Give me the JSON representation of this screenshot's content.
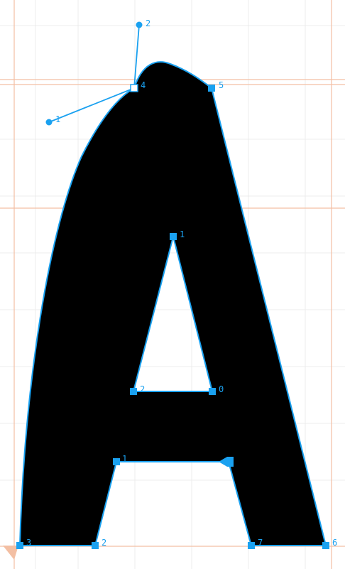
{
  "editor": {
    "glyph": "A",
    "colors": {
      "background": "#ffffff",
      "grid": "#ececec",
      "guide": "#f3bfa3",
      "glyph_fill": "#000000",
      "outline": "#1aa1f0",
      "node": "#1aa1f0",
      "selected_node": "#ffffff"
    }
  },
  "points": {
    "handle_top": "2",
    "handle_left": "1",
    "corner_top": "4",
    "corner_top_right": "5",
    "counter_top": "1",
    "counter_left": "2",
    "counter_right": "0",
    "bar_left": "1",
    "foot_left_outer": "3",
    "foot_left_inner": "2",
    "foot_right_inner": "7",
    "foot_right_outer": "6"
  }
}
